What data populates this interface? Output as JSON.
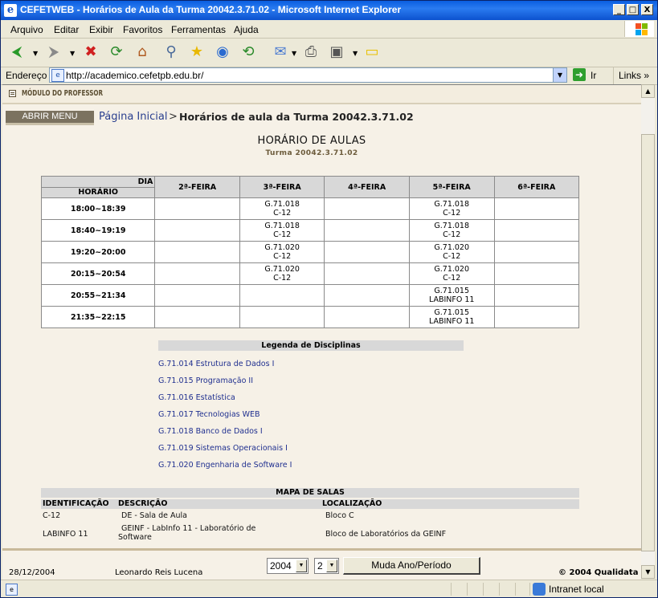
{
  "window": {
    "title": "CEFETWEB - Horários de Aula da Turma 20042.3.71.02 - Microsoft Internet Explorer",
    "controls": {
      "minimize": "_",
      "maximize": "□",
      "close": "X"
    }
  },
  "menu": {
    "items": [
      "Arquivo",
      "Editar",
      "Exibir",
      "Favoritos",
      "Ferramentas",
      "Ajuda"
    ]
  },
  "address": {
    "label": "Endereço",
    "url": "http://academico.cefetpb.edu.br/",
    "go_label": "Ir",
    "links_label": "Links"
  },
  "module": {
    "label": "MÓDULO DO PROFESSOR"
  },
  "breadcrumb": {
    "menu_button": "ABRIR MENU",
    "home": "Página Inicial",
    "separator": ">",
    "current": "Horários de aula da Turma 20042.3.71.02"
  },
  "page": {
    "title": "HORÁRIO DE AULAS",
    "subtitle": "Turma 20042.3.71.02"
  },
  "schedule": {
    "corner_day": "DIA",
    "corner_time": "HORÁRIO",
    "days": [
      "2ª-FEIRA",
      "3ª-FEIRA",
      "4ª-FEIRA",
      "5ª-FEIRA",
      "6ª-FEIRA"
    ],
    "rows": [
      {
        "time": "18:00~18:39",
        "cells": [
          [],
          [
            "G.71.018",
            "C-12"
          ],
          [],
          [
            "G.71.018",
            "C-12"
          ],
          []
        ]
      },
      {
        "time": "18:40~19:19",
        "cells": [
          [],
          [
            "G.71.018",
            "C-12"
          ],
          [],
          [
            "G.71.018",
            "C-12"
          ],
          []
        ]
      },
      {
        "time": "19:20~20:00",
        "cells": [
          [],
          [
            "G.71.020",
            "C-12"
          ],
          [],
          [
            "G.71.020",
            "C-12"
          ],
          []
        ]
      },
      {
        "time": "20:15~20:54",
        "cells": [
          [],
          [
            "G.71.020",
            "C-12"
          ],
          [],
          [
            "G.71.020",
            "C-12"
          ],
          []
        ]
      },
      {
        "time": "20:55~21:34",
        "cells": [
          [],
          [],
          [],
          [
            "G.71.015",
            "LABINFO 11"
          ],
          []
        ]
      },
      {
        "time": "21:35~22:15",
        "cells": [
          [],
          [],
          [],
          [
            "G.71.015",
            "LABINFO 11"
          ],
          []
        ]
      }
    ]
  },
  "legend": {
    "title": "Legenda de Disciplinas",
    "items": [
      "G.71.014 Estrutura de Dados I",
      "G.71.015 Programação II",
      "G.71.016 Estatística",
      "G.71.017 Tecnologias WEB",
      "G.71.018 Banco de Dados I",
      "G.71.019 Sistemas Operacionais I",
      "G.71.020 Engenharia de Software I"
    ]
  },
  "rooms": {
    "title": "MAPA DE SALAS",
    "columns": [
      "IDENTIFICAÇÃO",
      "DESCRIÇÃO",
      "LOCALIZAÇÃO"
    ],
    "rows": [
      {
        "id": "C-12",
        "desc_1": "DE - Sala de Aula",
        "desc_2": "",
        "location": "Bloco C"
      },
      {
        "id": "LABINFO 11",
        "desc_1": "GEINF - LabInfo 11 - Laboratório de",
        "desc_2": "Software",
        "location": "Bloco de Laboratórios da GEINF"
      }
    ]
  },
  "footer": {
    "date": "28/12/2004",
    "user": "Leonardo Reis Lucena",
    "year_value": "2004",
    "period_value": "2",
    "submit_label": "Muda Ano/Período",
    "copyright": "© 2004 Qualidata"
  },
  "status": {
    "zone": "Intranet local"
  }
}
